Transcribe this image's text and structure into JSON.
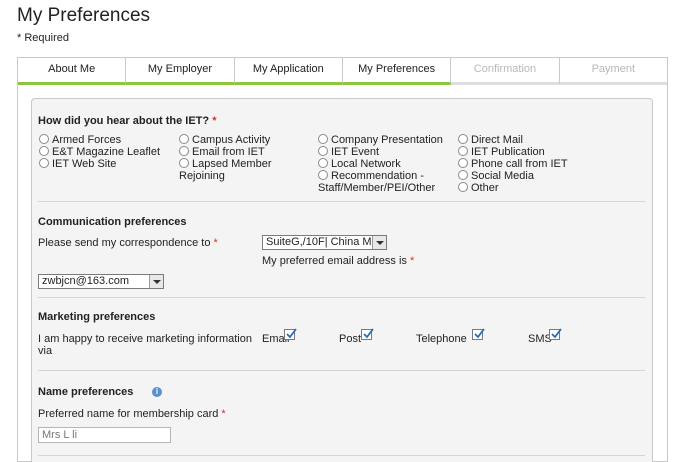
{
  "page": {
    "title": "My Preferences",
    "required_note": "* Required"
  },
  "tabs": [
    {
      "label": "About Me",
      "enabled": true
    },
    {
      "label": "My Employer",
      "enabled": true
    },
    {
      "label": "My Application",
      "enabled": true
    },
    {
      "label": "My Preferences",
      "enabled": true
    },
    {
      "label": "Confirmation",
      "enabled": false
    },
    {
      "label": "Payment",
      "enabled": false
    }
  ],
  "hear_about": {
    "question": "How did you hear about the IET?",
    "required_mark": "*",
    "options": [
      "Armed Forces",
      "E&T Magazine Leaflet",
      "IET Web Site",
      "Campus Activity",
      "Email from IET",
      "Lapsed Member",
      "Rejoining",
      "Company Presentation",
      "IET Event",
      "Local Network",
      "Recommendation -",
      "Staff/Member/PEI/Other",
      "Direct Mail",
      "IET Publication",
      "Phone call from IET",
      "Social Media",
      "Other"
    ]
  },
  "communication": {
    "title": "Communication preferences",
    "correspondence_label": "Please send my correspondence to",
    "correspondence_value": "SuiteG,/10F| China Mi",
    "email_label": "My preferred email address is",
    "email_value": "zwbjcn@163.com",
    "required_mark": "*"
  },
  "marketing": {
    "title": "Marketing preferences",
    "label_line1": "I am happy to receive marketing information",
    "label_line2": "via",
    "channels": [
      {
        "label": "Email",
        "checked": true
      },
      {
        "label": "Post",
        "checked": true
      },
      {
        "label": "Telephone",
        "checked": true
      },
      {
        "label": "SMS",
        "checked": true
      }
    ]
  },
  "name_prefs": {
    "title": "Name preferences",
    "info_glyph": "i",
    "card_label": "Preferred name for membership card",
    "required_mark": "*",
    "card_placeholder": "Mrs L li"
  }
}
